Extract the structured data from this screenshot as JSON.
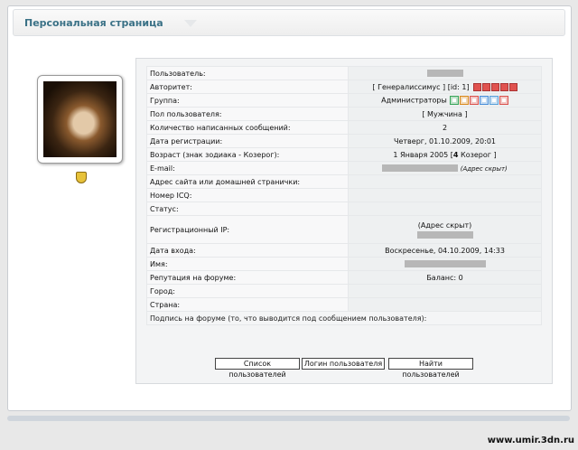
{
  "header": {
    "title": "Персональная страница"
  },
  "profile": {
    "rows": [
      {
        "label": "Пользователь:",
        "value": ""
      },
      {
        "label": "Авторитет:",
        "value": "[ Генералиссимус ] [id: 1]"
      },
      {
        "label": "Группа:",
        "value": "Администраторы"
      },
      {
        "label": "Пол пользователя:",
        "value": "[ Мужчина ]"
      },
      {
        "label": "Количество написанных сообщений:",
        "value": "2"
      },
      {
        "label": "Дата регистрации:",
        "value": "Четверг, 01.10.2009, 20:01"
      },
      {
        "label": "Возраст (знак зодиака - Козерог):",
        "value_pre": "1 Января 2005 [",
        "value_bold": "4",
        "value_post": " Козерог ]"
      },
      {
        "label": "E-mail:",
        "value": "(Адрес скрыт)"
      },
      {
        "label": "Адрес сайта или домашней странички:",
        "value": ""
      },
      {
        "label": "Номер ICQ:",
        "value": ""
      },
      {
        "label": "Статус:",
        "value": ""
      },
      {
        "label": "Регистрационный IP:",
        "value": "(Адрес скрыт)"
      },
      {
        "label": "Дата входа:",
        "value": "Воскресенье, 04.10.2009, 14:33"
      },
      {
        "label": "Имя:",
        "value": ""
      },
      {
        "label": "Репутация на форуме:",
        "value": "Баланс: 0"
      },
      {
        "label": "Город:",
        "value": ""
      },
      {
        "label": "Страна:",
        "value": ""
      }
    ],
    "signature_label": "Подпись на форуме (то, что выводится под сообщением пользователя):"
  },
  "rank_colors": [
    "#e0524f",
    "#e0524f",
    "#e0524f",
    "#e0524f",
    "#e0524f"
  ],
  "group_icon_colors": [
    "#3aa55a",
    "#d98a1f",
    "#d9534f",
    "#4a8fd9",
    "#5aa0d9",
    "#d9534f"
  ],
  "buttons": {
    "user_list": "Список пользователей",
    "user_logins": "Логин пользователя",
    "find_users": "Найти пользователей"
  },
  "watermark": "www.umir.3dn.ru",
  "icons": {
    "avatar": "user-avatar-photo",
    "rank": "shield-badge-icon"
  }
}
